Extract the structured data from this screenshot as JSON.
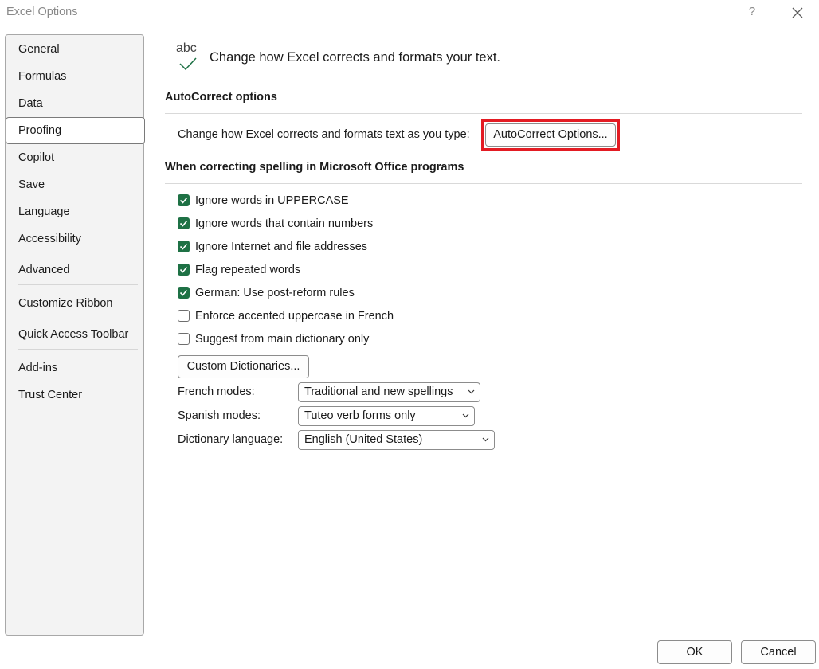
{
  "window": {
    "title": "Excel Options",
    "help": "?"
  },
  "sidebar": {
    "items": [
      {
        "label": "General"
      },
      {
        "label": "Formulas"
      },
      {
        "label": "Data"
      },
      {
        "label": "Proofing"
      },
      {
        "label": "Copilot"
      },
      {
        "label": "Save"
      },
      {
        "label": "Language"
      },
      {
        "label": "Accessibility"
      },
      {
        "label": "Advanced"
      },
      {
        "label": "Customize Ribbon"
      },
      {
        "label": "Quick Access Toolbar"
      },
      {
        "label": "Add-ins"
      },
      {
        "label": "Trust Center"
      }
    ],
    "selected": "Proofing"
  },
  "header": {
    "icon_text": "abc",
    "text": "Change how Excel corrects and formats your text."
  },
  "autocorrect": {
    "title": "AutoCorrect options",
    "label": "Change how Excel corrects and formats text as you type:",
    "button": "AutoCorrect Options..."
  },
  "spelling": {
    "title": "When correcting spelling in Microsoft Office programs",
    "options": [
      {
        "label": "Ignore words in UPPERCASE",
        "checked": true
      },
      {
        "label": "Ignore words that contain numbers",
        "checked": true
      },
      {
        "label": "Ignore Internet and file addresses",
        "checked": true
      },
      {
        "label": "Flag repeated words",
        "checked": true
      },
      {
        "label": "German: Use post-reform rules",
        "checked": true
      },
      {
        "label": "Enforce accented uppercase in French",
        "checked": false
      },
      {
        "label": "Suggest from main dictionary only",
        "checked": false
      }
    ],
    "custom_dict_button": "Custom Dictionaries...",
    "french_modes": {
      "label": "French modes:",
      "value": "Traditional and new spellings"
    },
    "spanish_modes": {
      "label": "Spanish modes:",
      "value": "Tuteo verb forms only"
    },
    "dictionary_language": {
      "label": "Dictionary language:",
      "value": "English (United States)"
    }
  },
  "footer": {
    "ok": "OK",
    "cancel": "Cancel"
  },
  "colors": {
    "accent_green": "#1e7145",
    "highlight_red": "#e31b23"
  },
  "icons": [
    "close-icon",
    "help-icon",
    "abc-check-icon",
    "checkmark-icon",
    "chevron-down-icon"
  ]
}
